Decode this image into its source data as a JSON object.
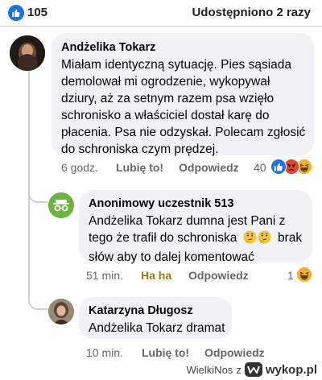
{
  "post_stats": {
    "like_count": "105",
    "shares": "Udostępniono 2 razy"
  },
  "comments": [
    {
      "author": "Andżelika Tokarz",
      "text": "Miałam identyczną sytuację. Pies sąsiada demolował mi ogrodzenie, wykopywał dziury, aż za setnym razem psa wzięło schronisko a właściciel dostał karę do płacenia. Psa nie odzyskał. Polecam zgłosić do schroniska czym prędzej.",
      "time": "6 godz.",
      "like_action": "Lubię to!",
      "reply_action": "Odpowiedz",
      "reaction_count": "40",
      "reaction_icons": [
        "like-icon",
        "angry-icon",
        "laugh-icon"
      ]
    },
    {
      "author": "Anonimowy uczestnik 513",
      "text_line1": "Andżelika Tokarz dumna jest Pani z",
      "text_line2a": "tego  że trafił do schroniska",
      "text_line2b": "brak",
      "text_line3": "słów aby to dalej komentować",
      "emojis": [
        "thinking-face-icon",
        "thinking-face-icon"
      ],
      "time": "51 min.",
      "like_action": "Ha ha",
      "reply_action": "Odpowiedz",
      "reaction_count": "1",
      "reaction_icons": [
        "laugh-icon"
      ]
    },
    {
      "author": "Katarzyna Długosz",
      "text": "Andżelika Tokarz dramat",
      "time": "10 min.",
      "like_action": "Lubię to!",
      "reply_action": "Odpowiedz"
    }
  ],
  "watermark": {
    "user": "WielkiNos",
    "separator": "z",
    "brand": "wykop.pl"
  },
  "colors": {
    "facebook_blue": "#1b74e4",
    "bubble_bg": "#f0f2f5",
    "meta_gray": "#65676b",
    "haha_yellow": "#f7b125"
  }
}
